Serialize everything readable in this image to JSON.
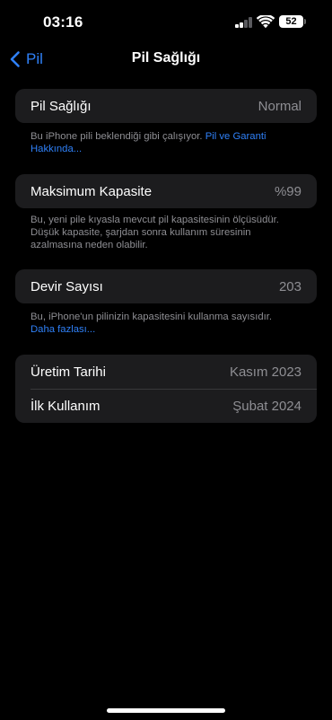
{
  "status_bar": {
    "time": "03:16",
    "battery_level": "52",
    "signal_icon": "cellular-signal-icon",
    "wifi_icon": "wifi-icon"
  },
  "nav": {
    "back_label": "Pil",
    "back_icon": "chevron-left-icon",
    "title": "Pil Sağlığı"
  },
  "colors": {
    "background": "#000000",
    "group_background": "#1c1c1e",
    "accent": "#2f80f7",
    "secondary_text": "#8e8e93",
    "separator": "#38383a"
  },
  "battery_health": {
    "label": "Pil Sağlığı",
    "value": "Normal",
    "footer_text": "Bu iPhone pili beklendiği gibi çalışıyor.",
    "footer_link": "Pil ve Garanti Hakkında..."
  },
  "max_capacity": {
    "label": "Maksimum Kapasite",
    "value": "%99",
    "footer_text": "Bu, yeni pile kıyasla mevcut pil kapasitesinin ölçüsüdür. Düşük kapasite, şarjdan sonra kullanım süresinin azalmasına neden olabilir."
  },
  "cycle_count": {
    "label": "Devir Sayısı",
    "value": "203",
    "footer_text": "Bu, iPhone'un pilinizin kapasitesini kullanma sayısıdır.",
    "footer_link": "Daha fazlası..."
  },
  "dates": {
    "manufacture": {
      "label": "Üretim Tarihi",
      "value": "Kasım 2023"
    },
    "first_use": {
      "label": "İlk Kullanım",
      "value": "Şubat 2024"
    }
  }
}
